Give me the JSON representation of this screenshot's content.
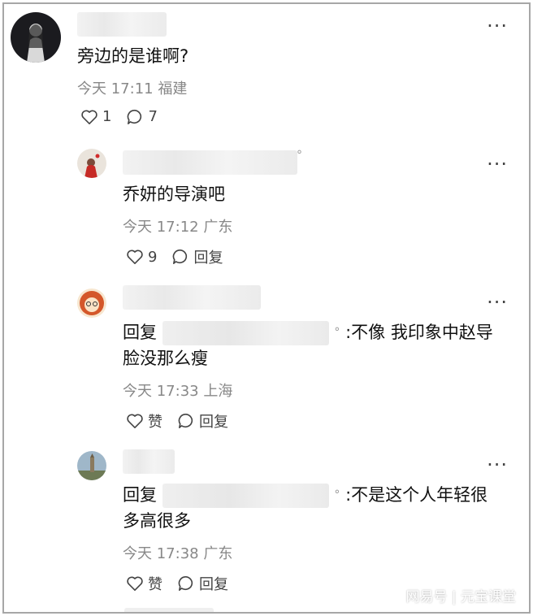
{
  "comments": [
    {
      "text": "旁边的是谁啊?",
      "time": "今天 17:11",
      "location": "福建",
      "likes": "1",
      "replies": "7"
    },
    {
      "text": "乔妍的导演吧",
      "time": "今天 17:12",
      "location": "广东",
      "likes": "9",
      "reply_label": "回复"
    },
    {
      "reply_prefix": "回复",
      "text_line1": ":不像 我印象中赵导",
      "text_line2": "脸没那么瘦",
      "time": "今天 17:33",
      "location": "上海",
      "like_label": "赞",
      "reply_label": "回复"
    },
    {
      "reply_prefix": "回复",
      "text_line1": ":不是这个人年轻很",
      "text_line2": "多高很多",
      "time": "今天 17:38",
      "location": "广东",
      "like_label": "赞",
      "reply_label": "回复"
    }
  ],
  "watermark": "网易号 | 元宝课堂",
  "colors": {
    "text": "#111111",
    "meta": "#888888",
    "border": "#a7a7a7"
  },
  "icons": [
    "heart-icon",
    "comment-bubble-icon",
    "more-icon"
  ]
}
